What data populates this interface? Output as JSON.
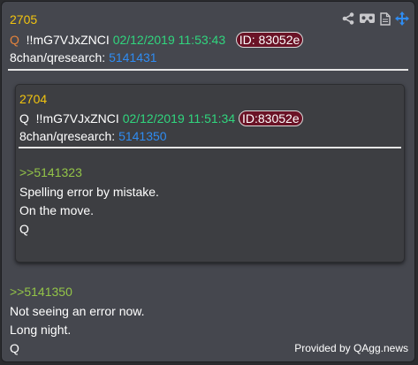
{
  "post": {
    "number": "2705",
    "q_mark": "Q",
    "tripcode": "!!mG7VJxZNCI",
    "date": "02/12/2019 11:53:43",
    "id_badge": "ID: 83052e",
    "board": "8chan/qresearch:",
    "post_id": "5141431",
    "reply_ref": ">>5141350",
    "lines": [
      "Not seeing an error now.",
      "Long night.",
      "Q"
    ]
  },
  "quoted": {
    "number": "2704",
    "q_mark": "Q",
    "tripcode": "!!mG7VJxZNCI",
    "date": "02/12/2019 11:51:34",
    "id_badge": "ID:83052e",
    "board": "8chan/qresearch:",
    "post_id": "5141350",
    "reply_ref": ">>5141323",
    "lines": [
      "Spelling error by mistake.",
      "On the move.",
      "Q"
    ]
  },
  "icons": [
    "share-icon",
    "vr-headset-icon",
    "document-icon",
    "move-arrows-icon"
  ],
  "footer": "Provided by QAgg.news",
  "colors": {
    "number": "#f2c40f",
    "date": "#30d67e",
    "link": "#2f8cf2",
    "reply": "#93c448",
    "id_badge": "#6a1326",
    "panel": "#45474e"
  }
}
